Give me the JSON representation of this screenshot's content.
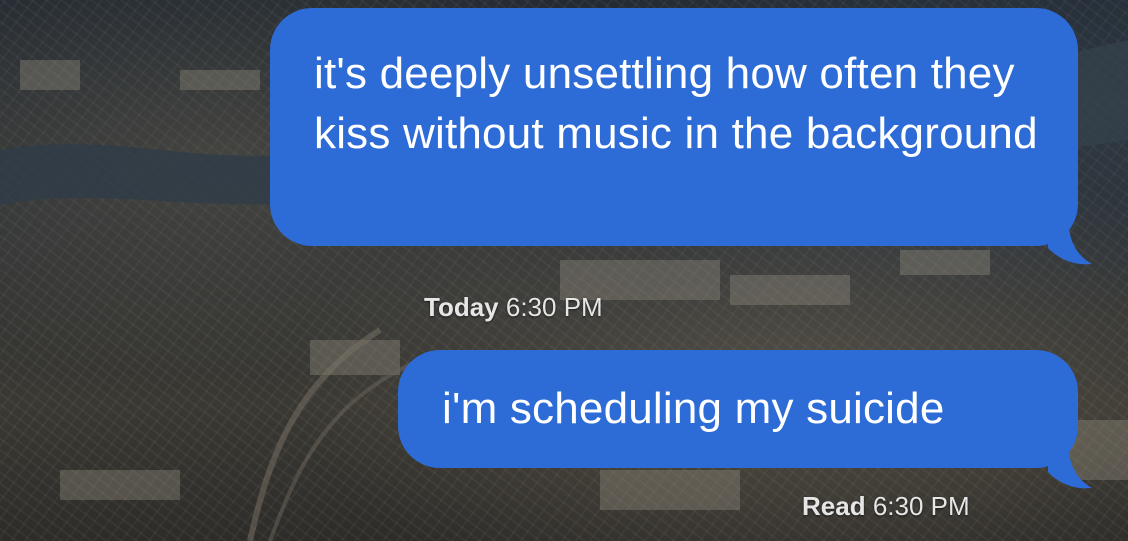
{
  "conversation": {
    "messages": [
      {
        "direction": "outgoing",
        "text": "it's deeply unsettling how often they kiss without music in the background",
        "bubble_color": "#2d6bd6"
      },
      {
        "direction": "outgoing",
        "text": "i'm scheduling my suicide",
        "bubble_color": "#2d6bd6"
      }
    ],
    "timestamps": [
      {
        "label": "Today",
        "time": "6:30 PM"
      },
      {
        "label": "Read",
        "time": "6:30 PM"
      }
    ]
  },
  "wallpaper": {
    "description": "aerial city photo background",
    "icon": "photo-wallpaper"
  }
}
